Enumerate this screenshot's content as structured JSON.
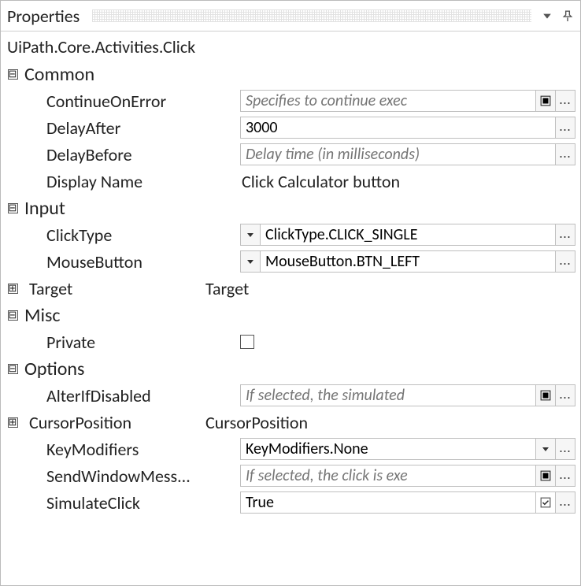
{
  "panel_title": "Properties",
  "type_name": "UiPath.Core.Activities.Click",
  "glyphs": {
    "collapse": "⊟",
    "expand": "⊞"
  },
  "categories": {
    "common": {
      "label": "Common",
      "continueOnError": {
        "name": "ContinueOnError",
        "placeholder": "Specifies to continue exec"
      },
      "delayAfter": {
        "name": "DelayAfter",
        "value": "3000"
      },
      "delayBefore": {
        "name": "DelayBefore",
        "placeholder": "Delay time (in milliseconds)"
      },
      "displayName": {
        "name": "Display Name",
        "value": "Click Calculator button"
      }
    },
    "input": {
      "label": "Input",
      "clickType": {
        "name": "ClickType",
        "value": "ClickType.CLICK_SINGLE"
      },
      "mouseButton": {
        "name": "MouseButton",
        "value": "MouseButton.BTN_LEFT"
      },
      "target": {
        "name": "Target",
        "value": "Target"
      }
    },
    "misc": {
      "label": "Misc",
      "private": {
        "name": "Private"
      }
    },
    "options": {
      "label": "Options",
      "alterIfDisabled": {
        "name": "AlterIfDisabled",
        "placeholder": "If selected, the simulated"
      },
      "cursorPosition": {
        "name": "CursorPosition",
        "value": "CursorPosition"
      },
      "keyModifiers": {
        "name": "KeyModifiers",
        "value": "KeyModifiers.None"
      },
      "sendWindowMessages": {
        "name": "SendWindowMess...",
        "placeholder": "If selected, the click is exe"
      },
      "simulateClick": {
        "name": "SimulateClick",
        "value": "True"
      }
    }
  }
}
